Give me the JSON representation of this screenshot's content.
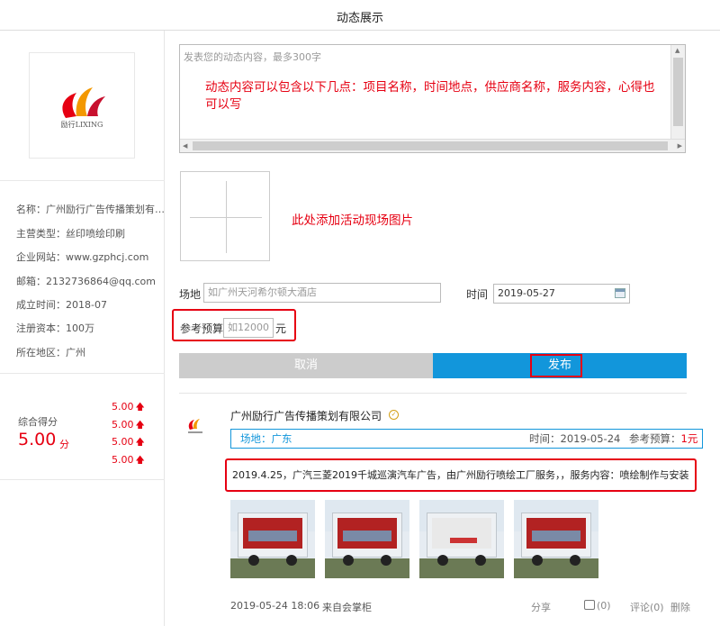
{
  "window": {
    "title": "动态展示"
  },
  "company_card": {
    "logo_text": "励行LIXING",
    "info": [
      "名称：广州励行广告传播策划有限公司",
      "主营类型：丝印喷绘印刷",
      "企业网站：www.gzphcj.com",
      "邮箱：2132736864@qq.com",
      "成立时间：2018-07",
      "注册资本：100万",
      "所在地区：广州"
    ],
    "score_label": "综合得分",
    "score_value": "5.00",
    "score_unit": "分",
    "sub_scores": [
      "5.00",
      "5.00",
      "5.00",
      "5.00"
    ],
    "accent_color": "#e60012"
  },
  "composer": {
    "textarea_placeholder": "发表您的动态内容，最多300字",
    "content_hint": "动态内容可以包含以下几点：项目名称，时间地点，供应商名称，服务内容，心得也可以写",
    "image_hint": "此处添加活动现场图片",
    "venue_label": "场地",
    "venue_placeholder": "如广州天河希尔顿大酒店",
    "time_label": "时间",
    "time_value": "2019-05-27",
    "budget_label": "参考预算",
    "budget_placeholder": "如12000",
    "budget_unit": "元",
    "cancel_label": "取消",
    "publish_label": "发布",
    "publish_color": "#1296db"
  },
  "post": {
    "company": "广州励行广告传播策划有限公司",
    "venue": "场地：广东",
    "time": "时间：2019-05-24",
    "budget_label": "参考预算：",
    "budget_value": "1元",
    "content": "2019.4.25，广汽三菱2019千城巡演汽车广告，由广州励行喷绘工厂服务，，服务内容：喷绘制作与安装",
    "photos": [
      "truck-photo-1",
      "truck-photo-2",
      "truck-photo-3",
      "truck-photo-4"
    ],
    "date": "2019-05-24 18:06",
    "source": "来自会掌柜",
    "share": "分享",
    "likes": "(0)",
    "comments": "评论(0)",
    "delete": "删除"
  }
}
